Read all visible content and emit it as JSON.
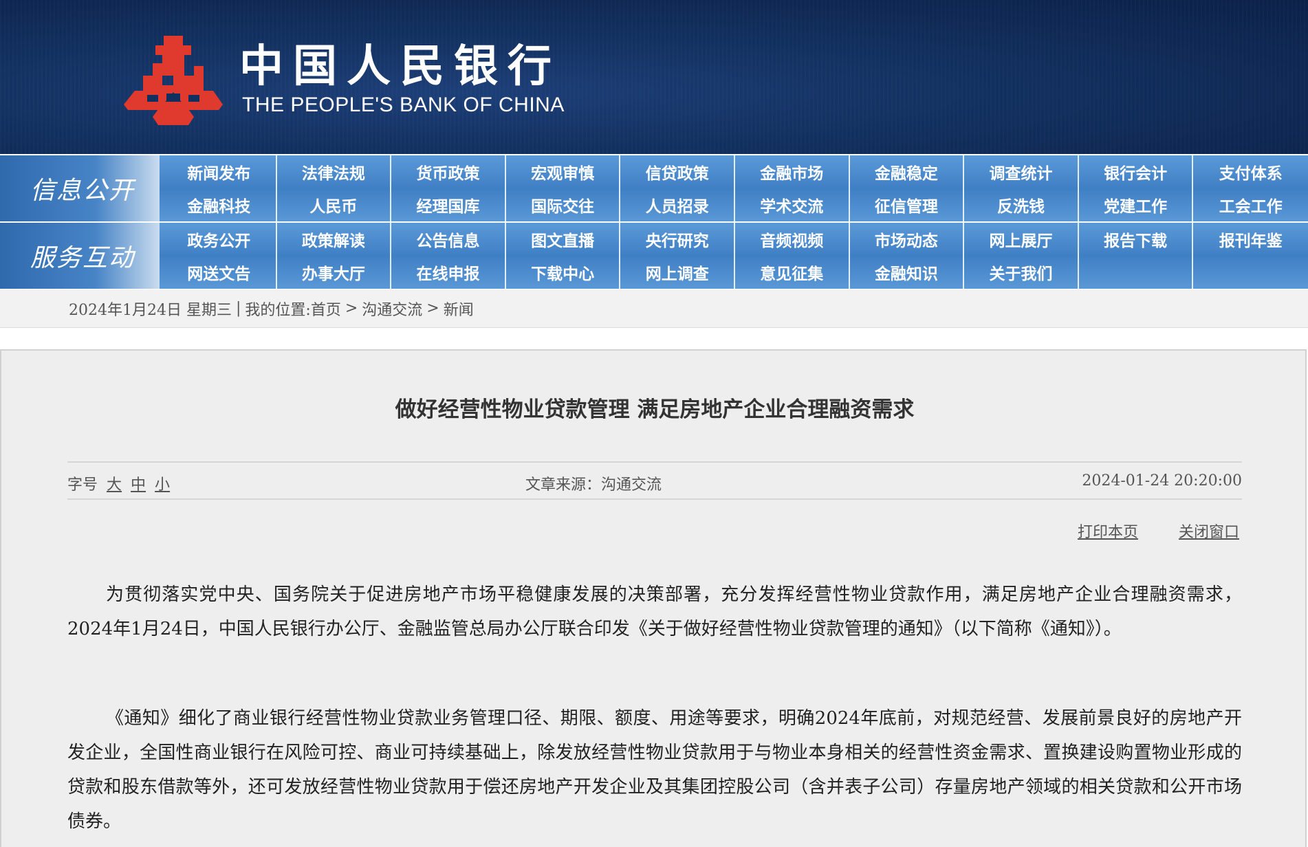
{
  "header": {
    "title_cn": "中国人民银行",
    "title_en": "THE PEOPLE'S BANK OF CHINA",
    "brand_red": "#e03a2f",
    "banner_blue": "#12305f"
  },
  "nav": {
    "group1": {
      "label": "信息公开",
      "items": [
        "新闻发布",
        "法律法规",
        "货币政策",
        "宏观审慎",
        "信贷政策",
        "金融市场",
        "金融稳定",
        "调查统计",
        "银行会计",
        "支付体系",
        "金融科技",
        "人民币",
        "经理国库",
        "国际交往",
        "人员招录",
        "学术交流",
        "征信管理",
        "反洗钱",
        "党建工作",
        "工会工作"
      ]
    },
    "group2": {
      "label": "服务互动",
      "items": [
        "政务公开",
        "政策解读",
        "公告信息",
        "图文直播",
        "央行研究",
        "音频视频",
        "市场动态",
        "网上展厅",
        "报告下载",
        "报刊年鉴",
        "网送文告",
        "办事大厅",
        "在线申报",
        "下载中心",
        "网上调查",
        "意见征集",
        "金融知识",
        "关于我们"
      ]
    }
  },
  "breadcrumb": {
    "date": "2024年1月24日 星期三",
    "sep": "|",
    "location_label": "我的位置:",
    "items": [
      "首页",
      "沟通交流",
      "新闻"
    ],
    "arrow": ">"
  },
  "article": {
    "title": "做好经营性物业贷款管理 满足房地产企业合理融资需求",
    "font_label": "字号",
    "font_sizes": [
      "大",
      "中",
      "小"
    ],
    "source": "文章来源：沟通交流",
    "datetime": "2024-01-24 20:20:00",
    "print_label": "打印本页",
    "close_label": "关闭窗口",
    "paragraphs": [
      "为贯彻落实党中央、国务院关于促进房地产市场平稳健康发展的决策部署，充分发挥经营性物业贷款作用，满足房地产企业合理融资需求，2024年1月24日，中国人民银行办公厅、金融监管总局办公厅联合印发《关于做好经营性物业贷款管理的通知》（以下简称《通知》）。",
      "《通知》细化了商业银行经营性物业贷款业务管理口径、期限、额度、用途等要求，明确2024年底前，对规范经营、发展前景良好的房地产开发企业，全国性商业银行在风险可控、商业可持续基础上，除发放经营性物业贷款用于与物业本身相关的经营性资金需求、置换建设购置物业形成的贷款和股东借款等外，还可发放经营性物业贷款用于偿还房地产开发企业及其集团控股公司（含并表子公司）存量房地产领域的相关贷款和公开市场债券。"
    ]
  }
}
